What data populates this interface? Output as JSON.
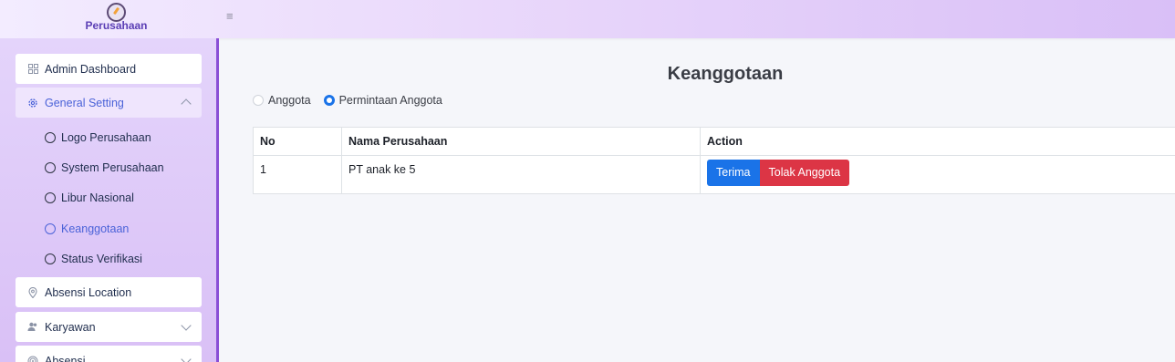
{
  "header": {
    "brand_name": "Perusahaan",
    "menu_icon": "hamburger-icon"
  },
  "sidebar": {
    "items": [
      {
        "label": "Admin Dashboard",
        "icon": "grid-icon"
      },
      {
        "label": "General Setting",
        "icon": "gear-icon",
        "expanded": true
      },
      {
        "label": "Absensi Location",
        "icon": "location-pin-icon"
      },
      {
        "label": "Karyawan",
        "icon": "users-icon"
      },
      {
        "label": "Absensi",
        "icon": "fingerprint-icon"
      }
    ],
    "sub_items": [
      {
        "label": "Logo Perusahaan"
      },
      {
        "label": "System Perusahaan"
      },
      {
        "label": "Libur Nasional"
      },
      {
        "label": "Keanggotaan",
        "active": true
      },
      {
        "label": "Status Verifikasi"
      }
    ]
  },
  "main": {
    "title": "Keanggotaan",
    "radio_options": [
      {
        "label": "Anggota",
        "checked": false
      },
      {
        "label": "Permintaan Anggota",
        "checked": true
      }
    ],
    "table": {
      "headers": [
        "No",
        "Nama Perusahaan",
        "Action"
      ],
      "rows": [
        {
          "no": "1",
          "nama": "PT anak ke 5",
          "accept_label": "Terima",
          "reject_label": "Tolak Anggota"
        }
      ]
    }
  },
  "colors": {
    "accent": "#4a62d8",
    "primary_button": "#1a73e8",
    "danger_button": "#dc3545",
    "sidebar_border": "#8a4fd6"
  }
}
